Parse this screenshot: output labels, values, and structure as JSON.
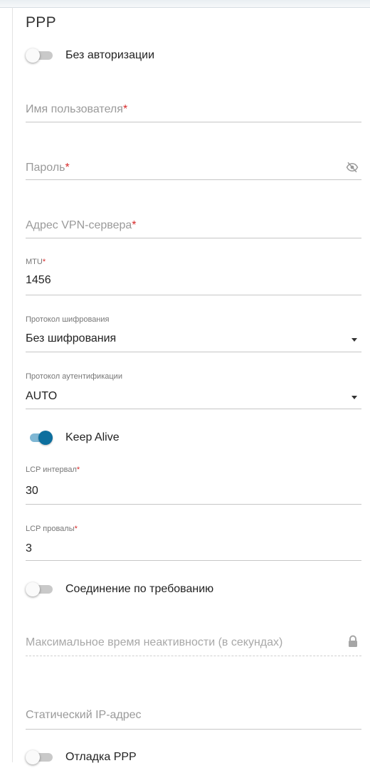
{
  "section_title": "PPP",
  "no_auth": {
    "label": "Без авторизации",
    "enabled": false
  },
  "username": {
    "label": "Имя пользователя",
    "required_mark": "*",
    "value": ""
  },
  "password": {
    "label": "Пароль",
    "required_mark": "*",
    "value": "",
    "icon": "eye-slash-icon"
  },
  "vpn_server": {
    "label": "Адрес VPN-сервера",
    "required_mark": "*",
    "value": ""
  },
  "mtu": {
    "label": "MTU",
    "required_mark": "*",
    "value": "1456"
  },
  "encryption": {
    "label": "Протокол шифрования",
    "value": "Без шифрования"
  },
  "auth_protocol": {
    "label": "Протокол аутентификации",
    "value": "AUTO"
  },
  "keep_alive": {
    "label": "Keep Alive",
    "enabled": true
  },
  "lcp_interval": {
    "label": "LCP интервал",
    "required_mark": "*",
    "value": "30"
  },
  "lcp_fails": {
    "label": "LCP провалы",
    "required_mark": "*",
    "value": "3"
  },
  "on_demand": {
    "label": "Соединение по требованию",
    "enabled": false
  },
  "max_idle": {
    "label": "Максимальное время неактивности (в секундах)",
    "icon": "lock-icon"
  },
  "static_ip": {
    "label": "Статический IP-адрес",
    "value": ""
  },
  "ppp_debug": {
    "label": "Отладка PPP",
    "enabled": false
  },
  "colors": {
    "accent": "#0d6f9e",
    "required": "#d72a2a"
  }
}
